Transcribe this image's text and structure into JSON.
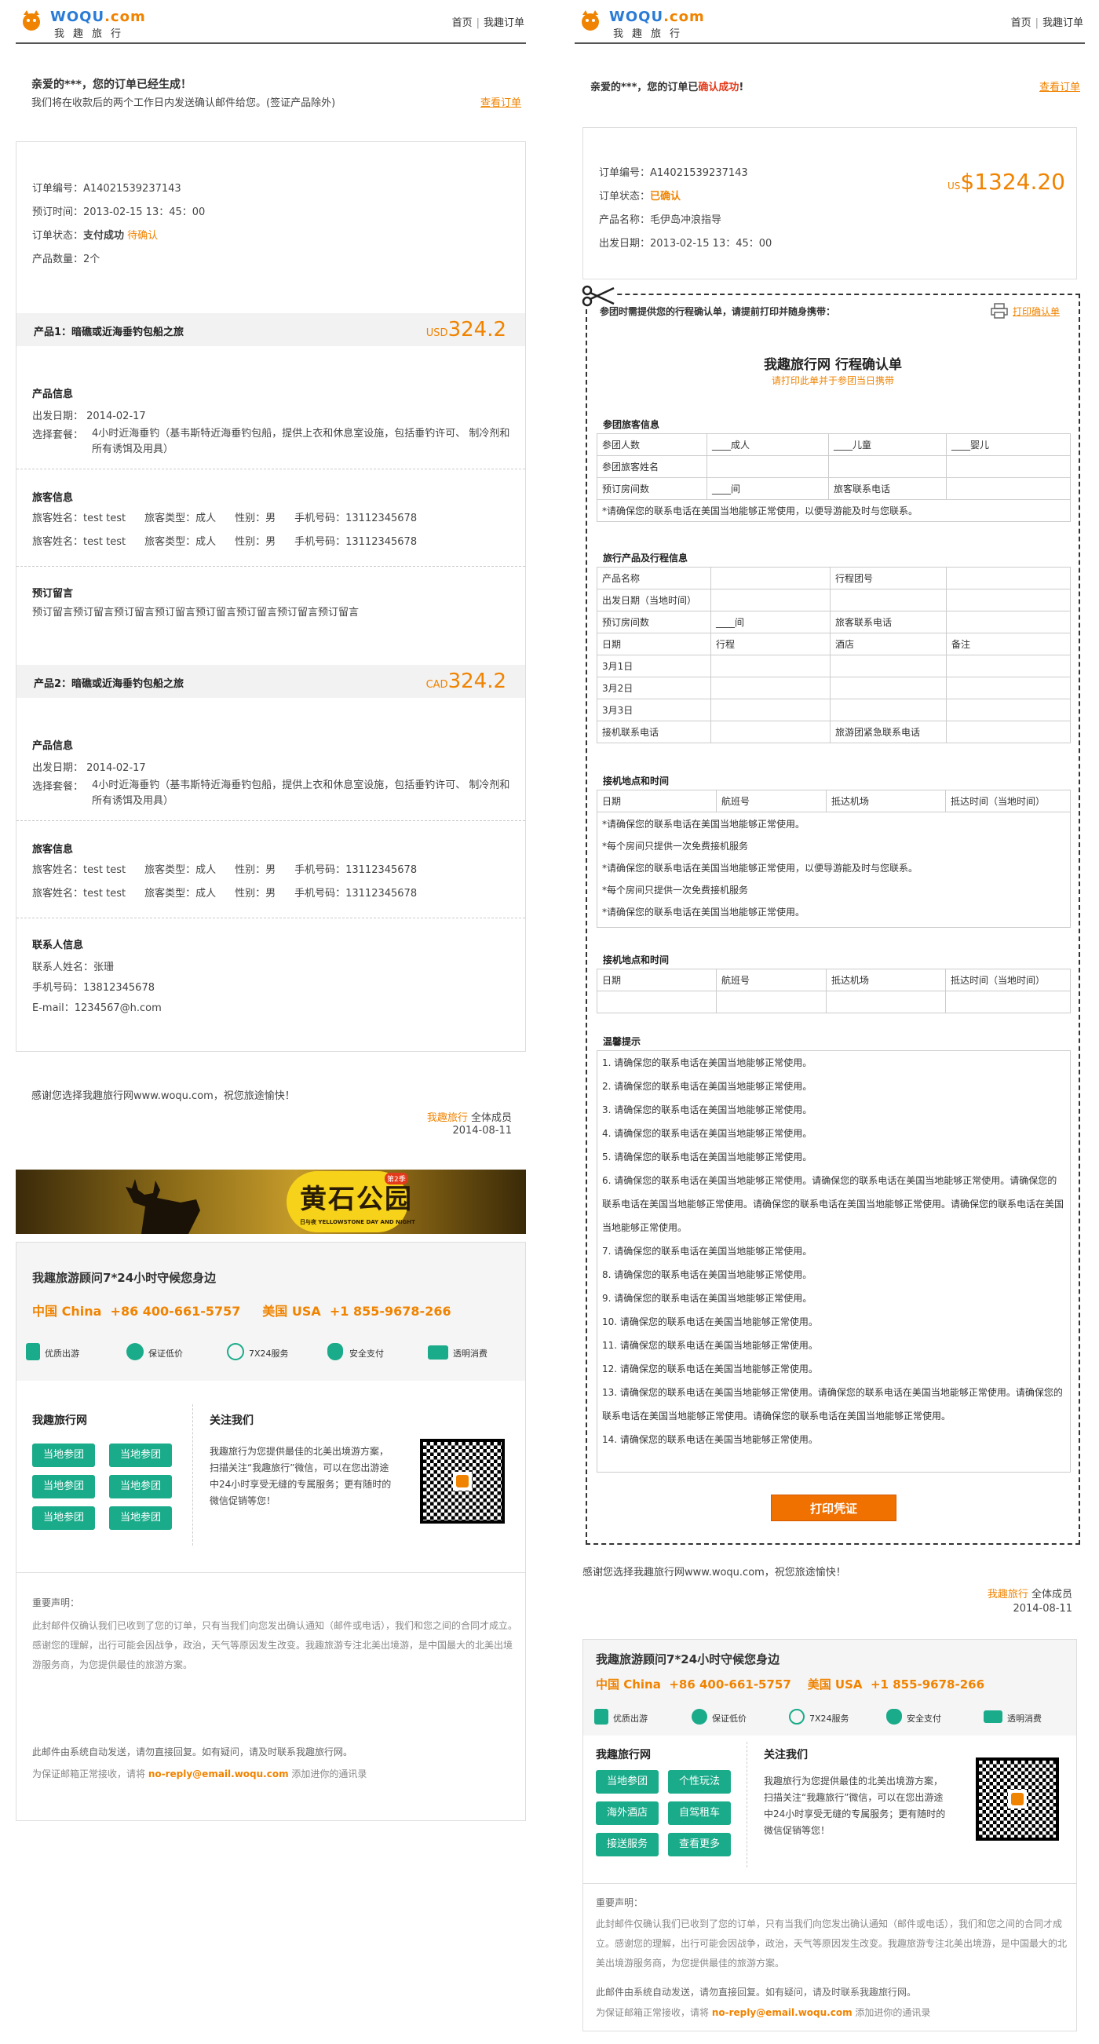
{
  "brand": {
    "name_main": "WOQU",
    "name_suffix": ".com",
    "name_cn": "我趣旅行"
  },
  "nav": {
    "home": "首页",
    "separator": "|",
    "my_orders": "我趣订单"
  },
  "left": {
    "greeting": "亲爱的***，您的订单已经生成！",
    "sub": "我们将在收款后的两个工作日内发送确认邮件给您。(签证产品除外)",
    "view_order": "查看订单",
    "order_no": "订单编号：A14021539237143",
    "order_time": "预订时间：2013-02-15 13：45：00",
    "status_label": "订单状态：",
    "status_paid": "支付成功",
    "status_pending": "待确认",
    "quantity": "产品数量：2个",
    "products": [
      {
        "title": "产品1：暗礁或近海垂钓包船之旅",
        "currency": "USD",
        "price": "324.2",
        "info_h": "产品信息",
        "date": "出发日期：  2014-02-17",
        "pkg_label": "选择套餐：",
        "pkg": "4小时近海垂钓（基韦斯特近海垂钓包船，提供上衣和休息室设施，包括垂钓许可、 制冷剂和所有诱饵及用具）",
        "trav_h": "旅客信息",
        "travelers": [
          {
            "name": "旅客姓名：test test",
            "type": "旅客类型：成人",
            "gender": "性别：男",
            "phone": "手机号码：13112345678"
          },
          {
            "name": "旅客姓名：test test",
            "type": "旅客类型：成人",
            "gender": "性别：男",
            "phone": "手机号码：13112345678"
          }
        ]
      },
      {
        "title": "产品2：暗礁或近海垂钓包船之旅",
        "currency": "CAD",
        "price": "324.2",
        "info_h": "产品信息",
        "date": "出发日期：  2014-02-17",
        "pkg_label": "选择套餐：",
        "pkg": "4小时近海垂钓（基韦斯特近海垂钓包船，提供上衣和休息室设施，包括垂钓许可、 制冷剂和所有诱饵及用具）",
        "trav_h": "旅客信息",
        "travelers": [
          {
            "name": "旅客姓名：test test",
            "type": "旅客类型：成人",
            "gender": "性别：男",
            "phone": "手机号码：13112345678"
          },
          {
            "name": "旅客姓名：test test",
            "type": "旅客类型：成人",
            "gender": "性别：男",
            "phone": "手机号码：13112345678"
          }
        ]
      }
    ],
    "msg_h": "预订留言",
    "msg": "预订留言预订留言预订留言预订留言预订留言预订留言预订留言预订留言",
    "contact_h": "联系人信息",
    "contact_name": "联系人姓名：张珊",
    "contact_phone": "手机号码：13812345678",
    "contact_email": "E-mail：1234567@h.com",
    "thanks": "感谢您选择我趣旅行网www.woqu.com，祝您旅途愉快！",
    "sign_brand": "我趣旅行",
    "sign_rest": " 全体成员",
    "sign_date": "2014-08-11",
    "banner_title": "黄石公园",
    "banner_badge": "第2季",
    "banner_sub": "日与夜 YELLOWSTONE DAY AND NIGHT"
  },
  "service": {
    "title": "我趣旅游顾问7*24小时守候您身边",
    "china_label": "中国 China",
    "china_phone": "+86 400-661-5757",
    "usa_label": "美国 USA",
    "usa_phone": "+1 855-9678-266",
    "features": [
      {
        "icon": "bag-icon",
        "label": "优质出游"
      },
      {
        "icon": "price-guarantee-icon",
        "label": "保证低价"
      },
      {
        "icon": "clock-icon",
        "label": "7X24服务"
      },
      {
        "icon": "shield-icon",
        "label": "安全支付"
      },
      {
        "icon": "card-icon",
        "label": "透明消费"
      }
    ],
    "wq_title": "我趣旅行网",
    "follow_title": "关注我们",
    "follow_text": "我趣旅行为您提供最佳的北美出境游方案，扫描关注“我趣旅行”微信，可以在您出游途中24小时享受无缝的专属服务；更有随时的微信促销等您！",
    "left_buttons": [
      "当地参团",
      "当地参团",
      "当地参团",
      "当地参团",
      "当地参团",
      "当地参团"
    ],
    "right_buttons": [
      "当地参团",
      "个性玩法",
      "海外酒店",
      "自驾租车",
      "接送服务",
      "查看更多"
    ],
    "notice_h": "重要声明：",
    "notice": "此封邮件仅确认我们已收到了您的订单，只有当我们向您发出确认通知（邮件或电话），我们和您之间的合同才成立。感谢您的理解，出行可能会因战争，政治，天气等原因发生改变。我趣旅游专注北美出境游，是中国最大的北美出境游服务商，为您提供最佳的旅游方案。",
    "auto": "此邮件由系统自动发送，请勿直接回复。如有疑问，请及时联系我趣旅行网。",
    "whitelist_pre": "为保证邮箱正常接收，请将 ",
    "whitelist_email": "no-reply@email.woqu.com",
    "whitelist_post": " 添加进你的通讯录"
  },
  "right": {
    "greeting_pre": "亲爱的***，您的订单已",
    "greeting_hl": "确认成功",
    "greeting_post": "!",
    "view_order": "查看订单",
    "order_no": "订单编号：A14021539237143",
    "status_label": "订单状态：",
    "status": "已确认",
    "product": "产品名称：毛伊岛冲浪指导",
    "date": "出发日期：2013-02-15 13：45：00",
    "currency": "US",
    "price": "$1324.20",
    "print_note": "参团时需提供您的行程确认单，请提前打印并随身携带：",
    "print_link": "打印确认单",
    "conf_title": "我趣旅行网 行程确认单",
    "conf_sub": "请打印此单并于参团当日携带",
    "sec1_h": "参团旅客信息",
    "sec1": {
      "count_label": "参团人数",
      "adult": "____成人",
      "child": "____儿童",
      "infant": "____婴儿",
      "names_label": "参团旅客姓名",
      "rooms_label": "预订房间数",
      "rooms": "____间",
      "contact_label": "旅客联系电话",
      "note": "*请确保您的联系电话在美国当地能够正常使用，以便导游能及时与您联系。"
    },
    "sec2_h": "旅行产品及行程信息",
    "sec2": {
      "pname": "产品名称",
      "group": "行程团号",
      "ddate": "出发日期（当地时间）",
      "rooms_label": "预订房间数",
      "rooms": "____间",
      "contact_label": "旅客联系电话",
      "cols": [
        "日期",
        "行程",
        "酒店",
        "备注"
      ],
      "days": [
        "3月1日",
        "3月2日",
        "3月3日"
      ],
      "pickup_phone": "接机联系电话",
      "emergency": "旅游团紧急联系电话"
    },
    "sec3_h": "接机地点和时间",
    "sec3_cols": [
      "日期",
      "航班号",
      "抵达机场",
      "抵达时间（当地时间）"
    ],
    "sec3_notes": [
      "*请确保您的联系电话在美国当地能够正常使用。",
      "*每个房间只提供一次免费接机服务",
      "*请确保您的联系电话在美国当地能够正常使用，以便导游能及时与您联系。",
      "*每个房间只提供一次免费接机服务",
      "*请确保您的联系电话在美国当地能够正常使用。"
    ],
    "sec4_h": "接机地点和时间",
    "sec4_cols": [
      "日期",
      "航班号",
      "抵达机场",
      "抵达时间（当地时间）"
    ],
    "tips_h": "温馨提示",
    "tips": [
      "1. 请确保您的联系电话在美国当地能够正常使用。",
      "2. 请确保您的联系电话在美国当地能够正常使用。",
      "3. 请确保您的联系电话在美国当地能够正常使用。",
      "4. 请确保您的联系电话在美国当地能够正常使用。",
      "5. 请确保您的联系电话在美国当地能够正常使用。",
      "6. 请确保您的联系电话在美国当地能够正常使用。请确保您的联系电话在美国当地能够正常使用。请确保您的联系电话在美国当地能够正常使用。请确保您的联系电话在美国当地能够正常使用。请确保您的联系电话在美国当地能够正常使用。",
      "7. 请确保您的联系电话在美国当地能够正常使用。",
      "8. 请确保您的联系电话在美国当地能够正常使用。",
      "9. 请确保您的联系电话在美国当地能够正常使用。",
      "10. 请确保您的联系电话在美国当地能够正常使用。",
      "11. 请确保您的联系电话在美国当地能够正常使用。",
      "12. 请确保您的联系电话在美国当地能够正常使用。",
      "13. 请确保您的联系电话在美国当地能够正常使用。请确保您的联系电话在美国当地能够正常使用。请确保您的联系电话在美国当地能够正常使用。请确保您的联系电话在美国当地能够正常使用。",
      "14. 请确保您的联系电话在美国当地能够正常使用。"
    ],
    "print_btn": "打印凭证",
    "thanks": "感谢您选择我趣旅行网www.woqu.com，祝您旅途愉快！",
    "sign_brand": "我趣旅行",
    "sign_rest": " 全体成员",
    "sign_date": "2014-08-11"
  }
}
